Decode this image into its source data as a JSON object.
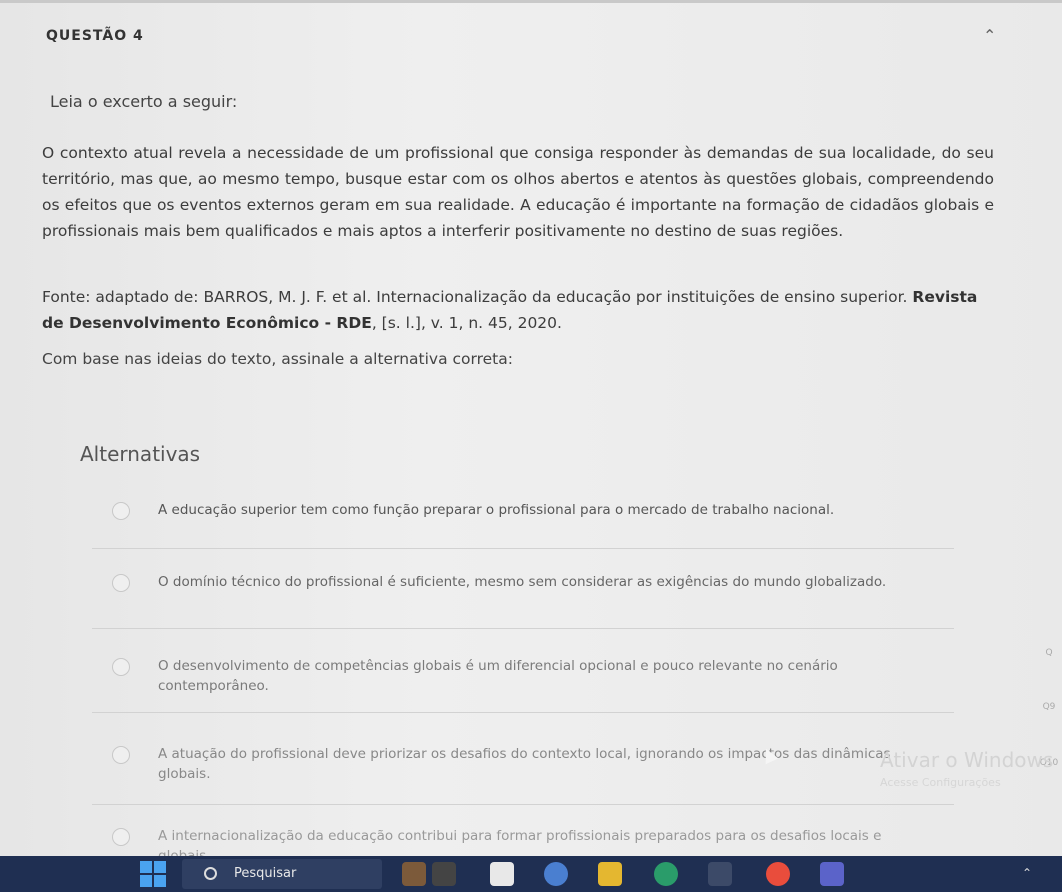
{
  "question": {
    "title": "QUESTÃO 4",
    "collapse_icon": "chevron-up-icon",
    "lead": "Leia o excerto a seguir:",
    "excerpt": "O contexto atual revela a necessidade de um profissional que consiga responder às demandas de sua localidade, do seu território, mas que, ao mesmo tempo, busque estar com os olhos abertos e atentos às questões globais, compreendendo os efeitos que os eventos externos geram em sua realidade. A educação é importante na formação de cidadãos globais e profissionais mais bem qualificados e mais aptos a interferir positivamente no destino de suas regiões.",
    "source_prefix": "Fonte: adaptado de: BARROS, M. J. F. et al. Internacionalização da educação por instituições de ensino superior. ",
    "source_journal": "Revista de Desenvolvimento Econômico - RDE",
    "source_suffix": ", [s. l.], v. 1, n. 45, 2020.",
    "prompt": "Com base nas ideias do texto, assinale a alternativa correta:"
  },
  "alternatives": {
    "title": "Alternativas",
    "options": [
      "A educação superior tem como função preparar o profissional para o mercado de trabalho nacional.",
      "O domínio técnico do profissional é suficiente, mesmo sem considerar as exigências do mundo globalizado.",
      "O desenvolvimento de competências globais é um diferencial opcional e pouco relevante no cenário contemporâneo.",
      "A atuação do profissional deve priorizar os desafios do contexto local, ignorando os impactos das dinâmicas globais.",
      "A internacionalização da educação contribui para formar profissionais preparados para os desafios locais e globais."
    ]
  },
  "side_nav": [
    "Q",
    "Q9",
    "Q10"
  ],
  "watermark": {
    "title": "Ativar o Windows",
    "subtitle": "Acesse Configurações"
  },
  "taskbar": {
    "search_label": "Pesquisar"
  }
}
